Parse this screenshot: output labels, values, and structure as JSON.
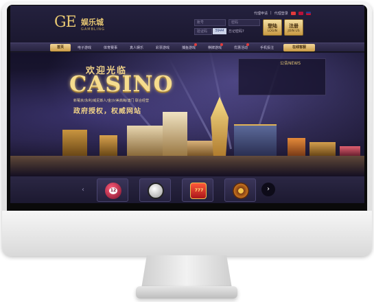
{
  "header": {
    "logo_mark": "GE",
    "logo_cn": "娱乐城",
    "logo_en": "GAMBLING",
    "top_links": [
      "代理申请",
      "代理登录"
    ],
    "username_placeholder": "账号",
    "password_placeholder": "密码",
    "captcha_placeholder": "验证码",
    "captcha_value": "5944",
    "forgot_label": "忘记密码?",
    "login_label_cn": "登陆",
    "login_label_en": "LOGIN",
    "join_label_cn": "注册",
    "join_label_en": "JOIN US"
  },
  "nav": {
    "home": "首页",
    "items": [
      "电子游戏",
      "体育赛事",
      "真人娱乐",
      "彩票游戏",
      "捕鱼游戏",
      "棋牌游戏",
      "优惠活动",
      "手机投注"
    ],
    "online_service": "在线客服"
  },
  "banner": {
    "welcome": "欢迎光临",
    "title": "CASINO",
    "partners": "新葡京/永利/威尼斯人/金沙/美高梅/澳门 联合经营",
    "slogan": "政府授权，权威网站",
    "notice_title": "公告NEWS"
  },
  "games": {
    "tiles": [
      {
        "name": "lottery",
        "icon": "lottery-ball-icon",
        "label": "12"
      },
      {
        "name": "sports",
        "icon": "soccer-ball-icon"
      },
      {
        "name": "slots",
        "icon": "slot-machine-icon",
        "label": "777"
      },
      {
        "name": "roulette",
        "icon": "roulette-icon"
      }
    ]
  },
  "colors": {
    "gold": "#e8c873",
    "nav_bg": "#2d2848",
    "banner_bg": "#1a1732"
  }
}
